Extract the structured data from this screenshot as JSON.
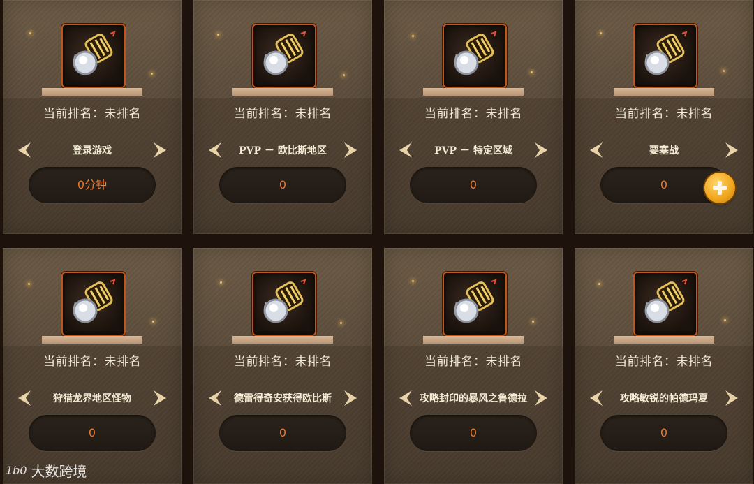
{
  "cards": [
    {
      "rank": "当前排名：未排名",
      "task": "登录游戏",
      "value": "0分钟",
      "has_plus": false
    },
    {
      "rank": "当前排名：未排名",
      "task": "PVP － 欧比斯地区",
      "value": "0",
      "has_plus": false
    },
    {
      "rank": "当前排名：未排名",
      "task": "PVP － 特定区域",
      "value": "0",
      "has_plus": false
    },
    {
      "rank": "当前排名：未排名",
      "task": "要塞战",
      "value": "0",
      "has_plus": true
    },
    {
      "rank": "当前排名：未排名",
      "task": "狩猎龙界地区怪物",
      "value": "0",
      "has_plus": false
    },
    {
      "rank": "当前排名：未排名",
      "task": "德雷得奇安获得欧比斯",
      "value": "0",
      "has_plus": false
    },
    {
      "rank": "当前排名：未排名",
      "task": "攻略封印的暴风之鲁德拉",
      "value": "0",
      "has_plus": false
    },
    {
      "rank": "当前排名：未排名",
      "task": "攻略敏锐的帕德玛夏",
      "value": "0",
      "has_plus": false
    }
  ],
  "watermark": {
    "logo": "1b0",
    "text": "大数跨境"
  },
  "colors": {
    "value_text": "#ee7a2e",
    "icon_border": "#c0551c",
    "plus_button": "#f2a81f"
  },
  "icons": {
    "item": "jewel-gauntlet-icon",
    "prev": "arrow-left-icon",
    "next": "arrow-right-icon",
    "add": "plus-icon"
  }
}
